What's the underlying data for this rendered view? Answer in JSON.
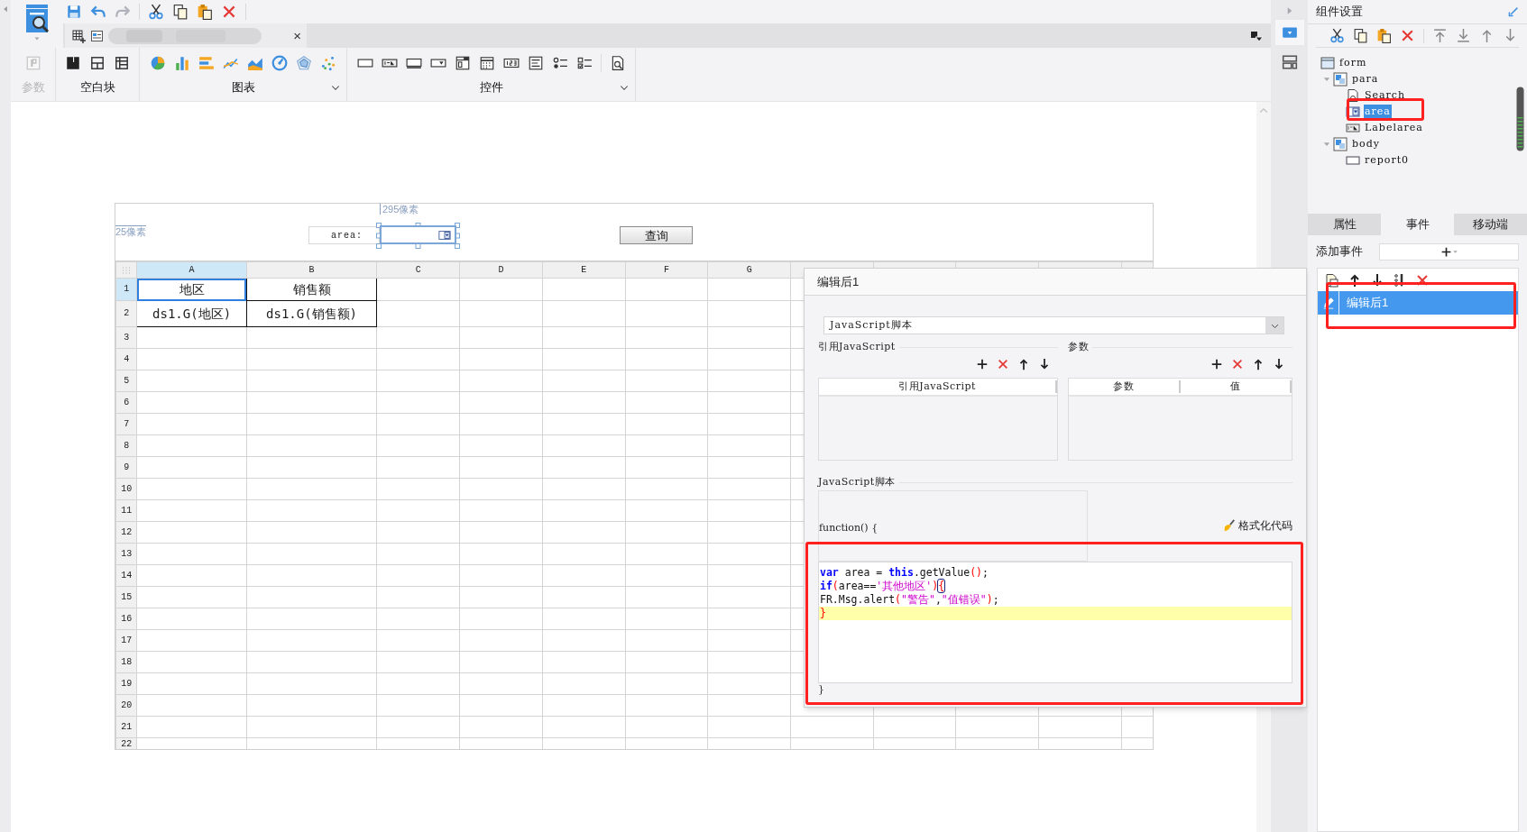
{
  "document_tab": {
    "close_glyph": "×"
  },
  "ribbon": {
    "groups": [
      {
        "label": "参数",
        "disabled": true,
        "has_menu": false
      },
      {
        "label": "空白块",
        "disabled": false,
        "has_menu": false
      },
      {
        "label": "图表",
        "disabled": false,
        "has_menu": true
      },
      {
        "label": "控件",
        "disabled": false,
        "has_menu": true
      }
    ]
  },
  "report": {
    "width_label": "295像素",
    "height_label": "25像素",
    "parameter_label": "area:",
    "query_button": "查询",
    "columns": [
      {
        "label": "A",
        "selected": true
      },
      {
        "label": "B",
        "selected": false
      },
      {
        "label": "C",
        "selected": false
      },
      {
        "label": "D",
        "selected": false
      },
      {
        "label": "E",
        "selected": false
      },
      {
        "label": "F",
        "selected": false
      },
      {
        "label": "G",
        "selected": false
      }
    ],
    "rows": [
      {
        "number": "1",
        "selected": true,
        "cells": [
          {
            "text": "地区",
            "selected": true
          },
          {
            "text": "销售额",
            "selected": false
          }
        ]
      },
      {
        "number": "2",
        "selected": false,
        "cells": [
          {
            "text": "ds1.G(地区)",
            "selected": false
          },
          {
            "text": "ds1.G(销售额)",
            "selected": false
          }
        ]
      },
      {
        "number": "3",
        "selected": false
      },
      {
        "number": "4",
        "selected": false
      },
      {
        "number": "5",
        "selected": false
      },
      {
        "number": "6",
        "selected": false
      },
      {
        "number": "7",
        "selected": false
      },
      {
        "number": "8",
        "selected": false
      },
      {
        "number": "9",
        "selected": false
      },
      {
        "number": "10",
        "selected": false
      },
      {
        "number": "11",
        "selected": false
      },
      {
        "number": "12",
        "selected": false
      },
      {
        "number": "13",
        "selected": false
      },
      {
        "number": "14",
        "selected": false
      },
      {
        "number": "15",
        "selected": false
      },
      {
        "number": "16",
        "selected": false
      },
      {
        "number": "17",
        "selected": false
      },
      {
        "number": "18",
        "selected": false
      },
      {
        "number": "19",
        "selected": false
      },
      {
        "number": "20",
        "selected": false
      },
      {
        "number": "21",
        "selected": false
      },
      {
        "number": "22",
        "selected": false
      }
    ]
  },
  "dialog": {
    "title": "编辑后1",
    "script_type": "JavaScript脚本",
    "reference_section": {
      "label": "引用JavaScript",
      "columns": [
        "引用JavaScript"
      ]
    },
    "parameter_section": {
      "label": "参数",
      "columns": [
        "参数",
        "值"
      ]
    },
    "script_section": {
      "label": "JavaScript脚本",
      "header": "function() {",
      "format_button": "格式化代码",
      "footer": "}",
      "code_lines": [
        {
          "current": false,
          "tokens": [
            {
              "text": "var",
              "kind": "keyword"
            },
            {
              "text": " area = ",
              "kind": "plain"
            },
            {
              "text": "this",
              "kind": "keyword"
            },
            {
              "text": ".getValue",
              "kind": "plain"
            },
            {
              "text": "()",
              "kind": "paren"
            },
            {
              "text": ";",
              "kind": "plain"
            }
          ]
        },
        {
          "current": false,
          "tokens": [
            {
              "text": "if",
              "kind": "keyword"
            },
            {
              "text": "(",
              "kind": "paren"
            },
            {
              "text": "area==",
              "kind": "plain"
            },
            {
              "text": "'其他地区'",
              "kind": "string"
            },
            {
              "text": ")",
              "kind": "paren"
            },
            {
              "text": "{",
              "kind": "match"
            }
          ]
        },
        {
          "current": false,
          "tokens": [
            {
              "text": "FR.Msg.alert",
              "kind": "plain"
            },
            {
              "text": "(",
              "kind": "paren"
            },
            {
              "text": "\"警告\"",
              "kind": "string"
            },
            {
              "text": ",",
              "kind": "plain"
            },
            {
              "text": "\"值错误\"",
              "kind": "string"
            },
            {
              "text": ")",
              "kind": "paren"
            },
            {
              "text": ";",
              "kind": "plain"
            }
          ]
        },
        {
          "current": true,
          "tokens": [
            {
              "text": "}",
              "kind": "paren"
            }
          ]
        }
      ]
    }
  },
  "component_panel": {
    "title": "组件设置",
    "tree": [
      {
        "label": "form",
        "kind": "form",
        "selected": false,
        "children": [
          {
            "label": "para",
            "kind": "container",
            "selected": false,
            "expanded": true,
            "children": [
              {
                "label": "Search",
                "kind": "button",
                "selected": false
              },
              {
                "label": "area",
                "kind": "combo",
                "selected": true
              },
              {
                "label": "Labelarea",
                "kind": "label",
                "selected": false
              }
            ]
          },
          {
            "label": "body",
            "kind": "container",
            "selected": false,
            "expanded": true,
            "children": [
              {
                "label": "report0",
                "kind": "report",
                "selected": false
              }
            ]
          }
        ]
      }
    ],
    "tabs": [
      {
        "label": "属性",
        "selected": false
      },
      {
        "label": "事件",
        "selected": true
      },
      {
        "label": "移动端",
        "selected": false
      }
    ],
    "add_event_label": "添加事件",
    "events": [
      {
        "name": "编辑后1",
        "selected": true
      }
    ]
  }
}
